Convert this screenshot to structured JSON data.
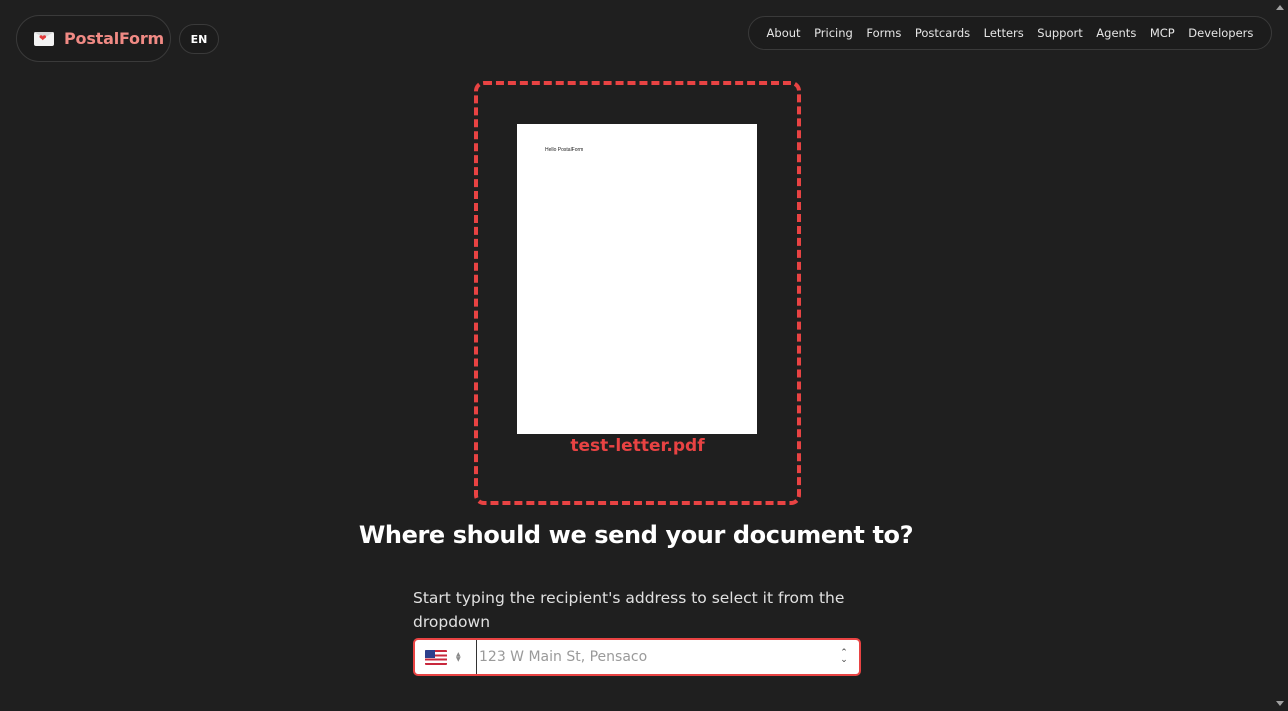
{
  "header": {
    "brand_name": "PostalForm",
    "logo_icon": "envelope-heart-icon",
    "language": "EN",
    "nav": [
      {
        "label": "About"
      },
      {
        "label": "Pricing"
      },
      {
        "label": "Forms"
      },
      {
        "label": "Postcards"
      },
      {
        "label": "Letters"
      },
      {
        "label": "Support"
      },
      {
        "label": "Agents"
      },
      {
        "label": "MCP"
      },
      {
        "label": "Developers"
      }
    ]
  },
  "document": {
    "preview_text": "Hello PostalForm",
    "file_name": "test-letter.pdf"
  },
  "main": {
    "heading": "Where should we send your document to?",
    "instruction": "Start typing the recipient's address to select it from the dropdown",
    "country_flag": "us-flag-icon",
    "address_placeholder": "123 W Main St, Pensaco"
  },
  "colors": {
    "background": "#1f1f1f",
    "accent": "#e84343",
    "brand": "#f08a84"
  }
}
